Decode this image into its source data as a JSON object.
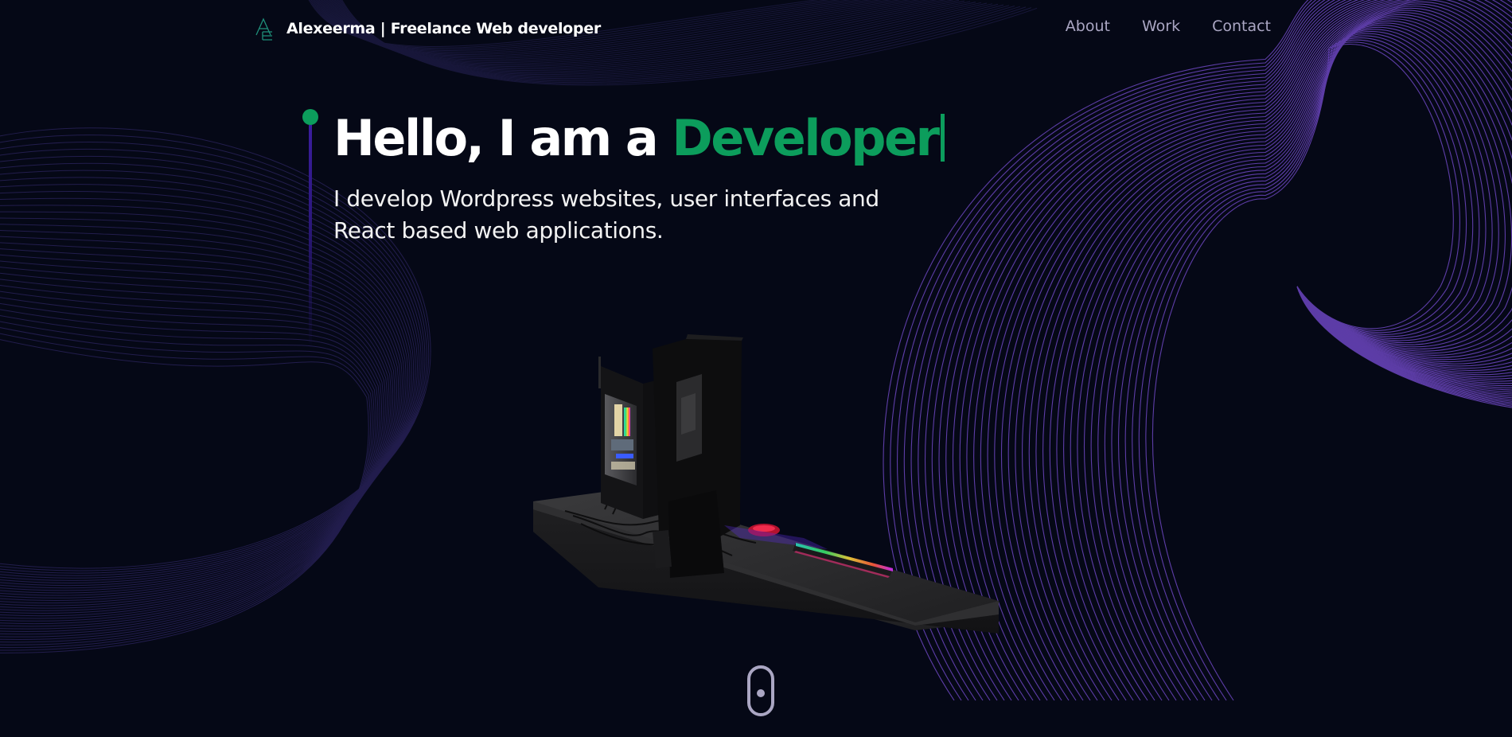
{
  "brand": {
    "logo_icon": "ae-monogram-logo",
    "name": "Alexeerma",
    "separator": "|",
    "tagline": "Freelance Web developer",
    "full_text": "Alexeerma  | Freelance Web developer"
  },
  "nav": {
    "links": [
      {
        "label": "About"
      },
      {
        "label": "Work"
      },
      {
        "label": "Contact"
      }
    ]
  },
  "hero": {
    "title_prefix": "Hello, I am a ",
    "title_accent": "Developer",
    "subtitle": "I develop Wordpress websites, user interfaces and React based web applications."
  },
  "scene": {
    "description_icon": "desk-computer-3d-model"
  },
  "scroll": {
    "icon": "mouse-scroll-icon"
  },
  "colors": {
    "background": "#050816",
    "accent_green": "#0c9d5c",
    "wave_purple": "#7b4fd8",
    "nav_text": "#aaa6c3",
    "white": "#ffffff"
  }
}
